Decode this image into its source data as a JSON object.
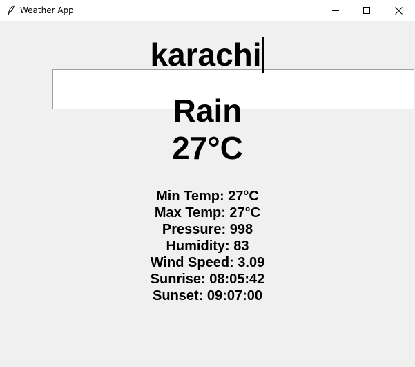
{
  "window": {
    "title": "Weather App",
    "icon": "feather-icon",
    "controls": [
      "minimize-icon",
      "maximize-icon",
      "close-icon"
    ]
  },
  "search": {
    "value": "karachi"
  },
  "weather": {
    "condition": "Rain",
    "temperature": "27°C",
    "details": {
      "min_temp": "Min Temp: 27°C",
      "max_temp": "Max Temp: 27°C",
      "pressure": "Pressure: 998",
      "humidity": "Humidity: 83",
      "wind_speed": "Wind Speed: 3.09",
      "sunrise": "Sunrise: 08:05:42",
      "sunset": "Sunset: 09:07:00"
    }
  },
  "colors": {
    "window_bg": "#f0f0f0",
    "titlebar_bg": "#ffffff",
    "input_bg": "#ffffff",
    "text": "#000000"
  }
}
